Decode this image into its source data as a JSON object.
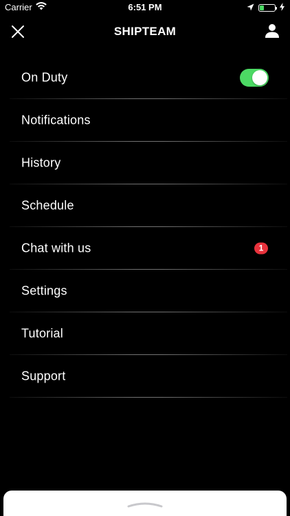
{
  "status_bar": {
    "carrier": "Carrier",
    "time": "6:51 PM",
    "battery_level": 0.3,
    "icons": [
      "wifi-icon",
      "location-arrow-icon",
      "battery-icon",
      "charging-bolt-icon"
    ]
  },
  "header": {
    "title": "SHIPTEAM",
    "left_icon": "close-icon",
    "right_icon": "user-profile-icon"
  },
  "menu": {
    "on_duty": {
      "label": "On Duty",
      "toggle_on": true
    },
    "items": [
      {
        "label": "Notifications"
      },
      {
        "label": "History"
      },
      {
        "label": "Schedule"
      },
      {
        "label": "Chat with us",
        "badge": "1"
      },
      {
        "label": "Settings"
      },
      {
        "label": "Tutorial"
      },
      {
        "label": "Support"
      }
    ]
  },
  "bottom_sheet": {
    "handle_icon": "chevron-up-icon"
  },
  "colors": {
    "background": "#000000",
    "text": "#ffffff",
    "toggle_on": "#4cd964",
    "badge": "#e8323c",
    "battery": "#4cd964"
  }
}
